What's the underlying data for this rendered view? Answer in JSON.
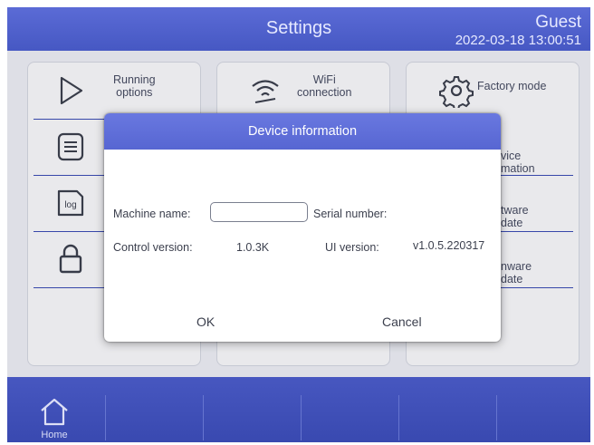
{
  "header": {
    "title": "Settings",
    "user": "Guest",
    "datetime": "2022-03-18 13:00:51"
  },
  "menu": {
    "running_options": [
      "Running",
      "options"
    ],
    "wifi": [
      "WiFi",
      "connection"
    ],
    "factory_mode": "Factory mode",
    "device_info_partial": [
      "vice",
      "mation"
    ],
    "software_update_partial": [
      "tware",
      "date"
    ],
    "firmware_update_partial": [
      "nware",
      "date"
    ]
  },
  "footer": {
    "home_label": "Home"
  },
  "dialog": {
    "title": "Device information",
    "machine_name_label": "Machine name:",
    "machine_name_value": "",
    "serial_number_label": "Serial number:",
    "control_version_label": "Control version:",
    "control_version_value": "1.0.3K",
    "ui_version_label": "UI version:",
    "ui_version_value": "v1.0.5.220317",
    "ok_label": "OK",
    "cancel_label": "Cancel"
  },
  "colors": {
    "accent": "#4658c3",
    "dialog_header": "#5e6dd8"
  },
  "icons": [
    "play-icon",
    "wifi-icon",
    "gear-icon",
    "document-icon",
    "log-icon",
    "lock-icon",
    "home-icon"
  ]
}
